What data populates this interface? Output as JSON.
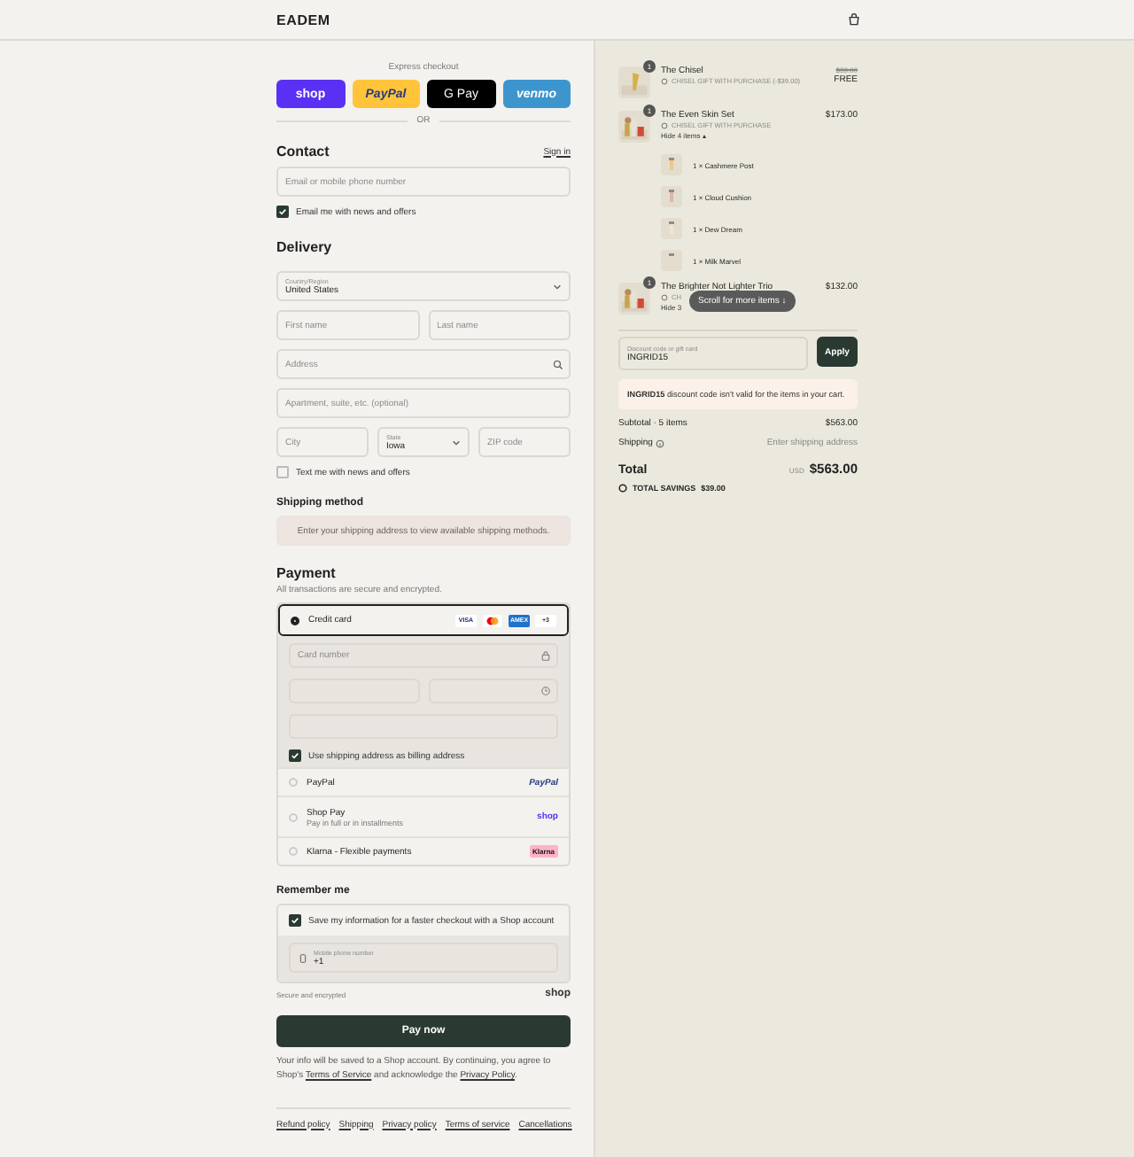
{
  "header": {
    "logo": "EADEM"
  },
  "express": {
    "label": "Express checkout",
    "divider": "OR",
    "buttons": [
      {
        "kind": "shop",
        "label": "shop"
      },
      {
        "kind": "paypal",
        "label": "PayPal"
      },
      {
        "kind": "gpay",
        "label": "G Pay"
      },
      {
        "kind": "venmo",
        "label": "venmo"
      }
    ]
  },
  "contact": {
    "title": "Contact",
    "link": "Sign in",
    "field": {
      "placeholder": "Email or mobile phone number"
    },
    "newsletter": {
      "label": "Email me with news and offers",
      "checked": true
    }
  },
  "delivery": {
    "title": "Delivery",
    "rows": [
      {
        "fields": [
          {
            "kind": "select",
            "label": "Country/Region",
            "value": "United States"
          }
        ]
      },
      {
        "fields": [
          {
            "kind": "text",
            "placeholder": "First name"
          },
          {
            "kind": "text",
            "placeholder": "Last name"
          }
        ]
      },
      {
        "fields": [
          {
            "kind": "search",
            "placeholder": "Address"
          }
        ]
      },
      {
        "fields": [
          {
            "kind": "text",
            "placeholder": "Apartment, suite, etc. (optional)"
          }
        ]
      },
      {
        "fields": [
          {
            "kind": "text",
            "placeholder": "City"
          },
          {
            "kind": "select",
            "label": "State",
            "value": "Iowa"
          },
          {
            "kind": "text",
            "placeholder": "ZIP code"
          }
        ]
      }
    ],
    "sms": {
      "label": "Text me with news and offers",
      "checked": false
    }
  },
  "shipping_method": {
    "title": "Shipping method",
    "notice": "Enter your shipping address to view available shipping methods."
  },
  "payment": {
    "title": "Payment",
    "subtitle": "All transactions are secure and encrypted.",
    "methods": [
      {
        "kind": "card",
        "label": "Credit card",
        "selected": true,
        "brands": [
          {
            "kind": "visa",
            "label": "VISA"
          },
          {
            "kind": "mastercard"
          },
          {
            "kind": "amex",
            "label": "AMEX"
          },
          {
            "kind": "more",
            "label": "+3"
          }
        ],
        "card_number": {
          "placeholder": "Card number"
        },
        "billing": {
          "label": "Use shipping address as billing address",
          "checked": true
        }
      },
      {
        "kind": "paypal",
        "label": "PayPal",
        "selected": false,
        "logo": "PayPal"
      },
      {
        "kind": "shop",
        "label": "Shop Pay",
        "sublabel": "Pay in full or in installments",
        "selected": false,
        "logo": "shop"
      },
      {
        "kind": "klarna",
        "label": "Klarna - Flexible payments",
        "selected": false,
        "logo": "Klarna"
      }
    ]
  },
  "remember": {
    "title": "Remember me",
    "save": {
      "label": "Save my information for a faster checkout with a Shop account",
      "checked": true
    },
    "phone": {
      "label": "Mobile phone number",
      "value": "+1"
    },
    "secure": "Secure and encrypted",
    "logo": "shop"
  },
  "pay_button": "Pay now",
  "legal": {
    "before": "Your info will be saved to a Shop account. By continuing, you agree to Shop's ",
    "link1": "Terms of Service",
    "middle": " and acknowledge the ",
    "link2": "Privacy Policy",
    "after": "."
  },
  "footer_links": [
    "Refund policy",
    "Shipping",
    "Privacy policy",
    "Terms of service",
    "Cancellations"
  ],
  "cart": {
    "items": [
      {
        "name": "The Chisel",
        "quantity": "1",
        "gift": "CHISEL GIFT WITH PURCHASE (-$39.00)",
        "original_price": "$39.00",
        "price": "FREE"
      },
      {
        "name": "The Even Skin Set",
        "quantity": "1",
        "gift": "CHISEL GIFT WITH PURCHASE",
        "price": "$173.00",
        "toggle": "Hide 4 items ▴",
        "children": [
          {
            "label": "1 × Cashmere Post"
          },
          {
            "label": "1 × Cloud Cushion"
          },
          {
            "label": "1 × Dew Dream"
          },
          {
            "label": "1 × Milk Marvel"
          }
        ]
      },
      {
        "name": "The Brighter Not Lighter Trio",
        "quantity": "1",
        "gift": "CH",
        "price": "$132.00",
        "toggle": "Hide 3"
      }
    ],
    "tooltip": "Scroll for more items ↓",
    "discount": {
      "label": "Discount code or gift card",
      "value": "INGRID15",
      "button": "Apply",
      "error": "**INGRID15** discount code isn't valid for the items in your cart."
    },
    "summary": {
      "subtotal_label": "Subtotal · 5 items",
      "subtotal": "$563.00",
      "shipping_label": "Shipping",
      "shipping": "Enter shipping address",
      "total_label": "Total",
      "currency": "USD",
      "total": "$563.00",
      "savings_label": "TOTAL SAVINGS",
      "savings": "$39.00"
    }
  }
}
